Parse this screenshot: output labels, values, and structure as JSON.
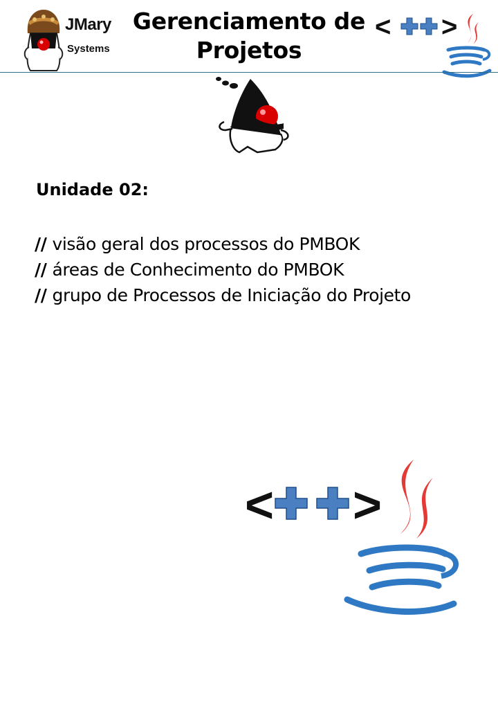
{
  "header": {
    "brand": {
      "name": "JMary",
      "sub": "Systems"
    },
    "title": "Gerenciamento de Projetos"
  },
  "content": {
    "unit_heading": "Unidade 02:",
    "comment_marker": "//",
    "topics": [
      "visão geral dos processos do PMBOK",
      "áreas de Conhecimento do PMBOK",
      "grupo de Processos de Iniciação do Projeto"
    ]
  },
  "logos": {
    "cpp_text": "<++>",
    "colors": {
      "plus_blue": "#4a7fc1",
      "java_red": "#e53935",
      "java_blue": "#2f78c4",
      "rule": "#2e6e8a"
    }
  }
}
